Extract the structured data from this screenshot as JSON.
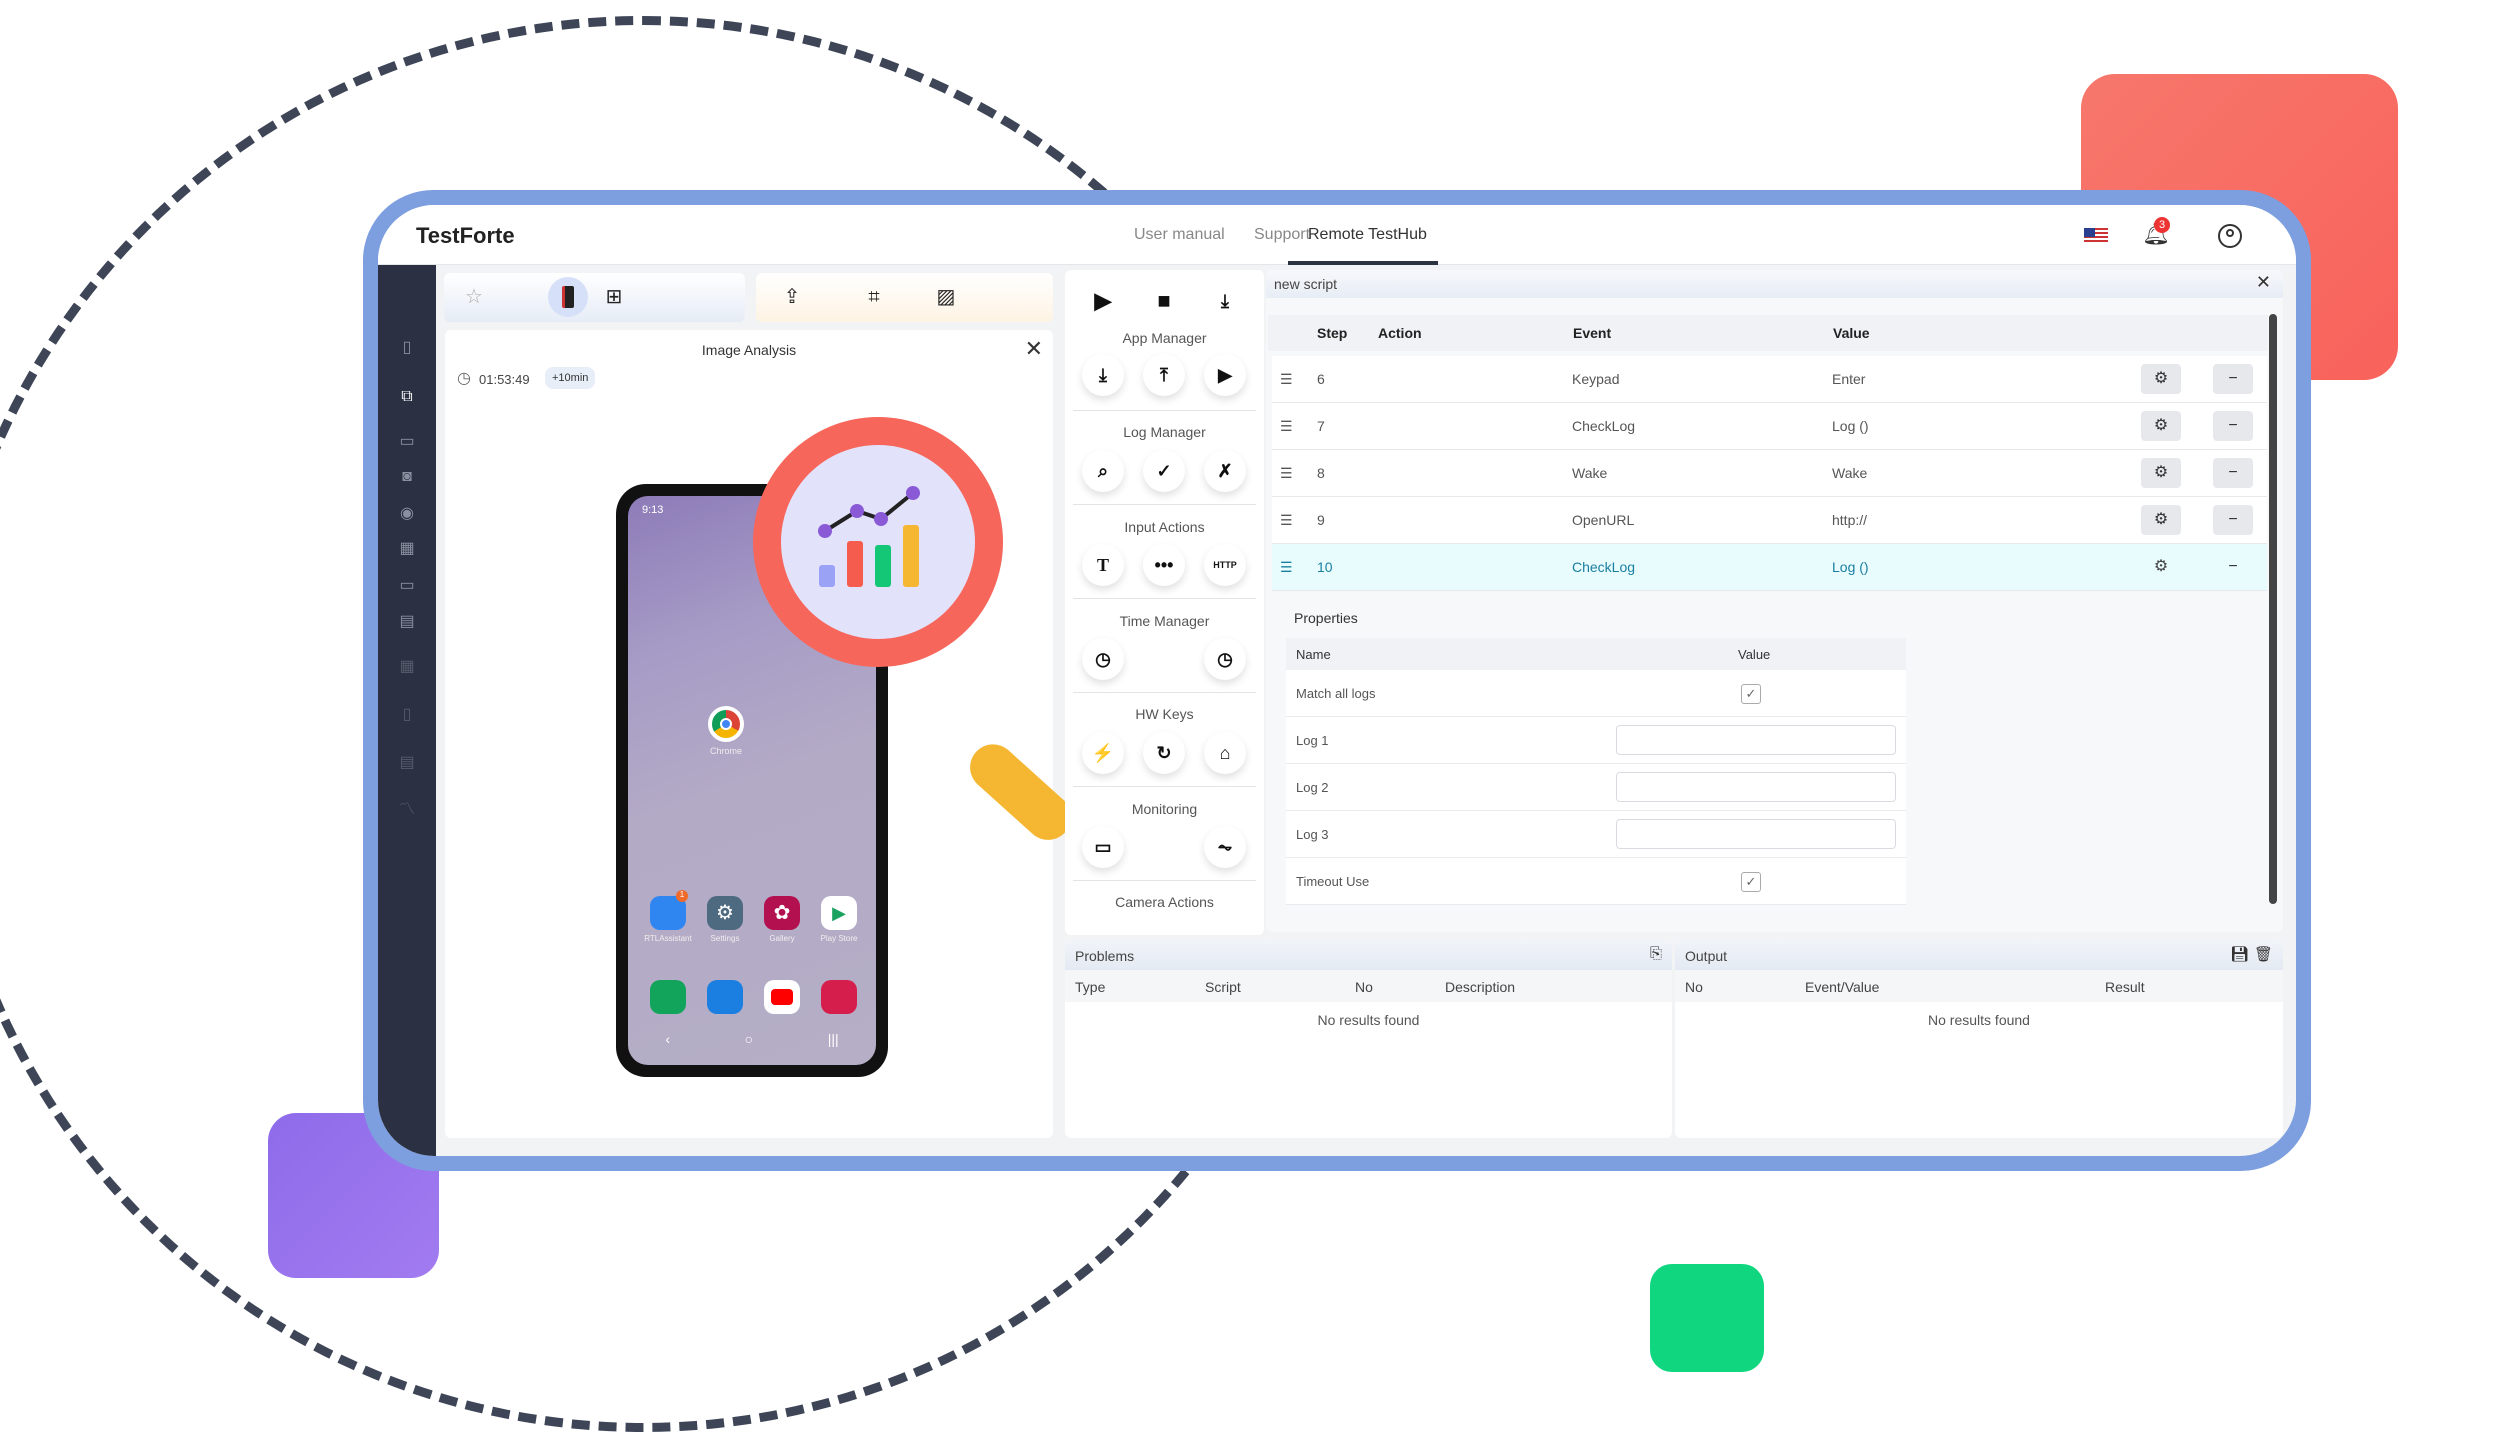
{
  "app": {
    "title": "TestForte"
  },
  "nav": {
    "user_manual": "User manual",
    "support": "Support",
    "remote": "Remote TestHub",
    "notification_count": "3"
  },
  "colors": {
    "frame": "#7d9fe0",
    "sidebar": "#2b3142",
    "highlight_row": "#e8fbfd",
    "accent_text": "#1a7fa0"
  },
  "image_analysis": {
    "title": "Image Analysis",
    "timer": "01:53:49",
    "extend": "+10min"
  },
  "phone": {
    "time": "9:13",
    "apps": [
      "Chrome",
      "RTLAssistant",
      "Settings",
      "Gallery",
      "Play Store"
    ],
    "badge": "1"
  },
  "tools": {
    "sections": [
      "App Manager",
      "Log Manager",
      "Input Actions",
      "Time Manager",
      "HW Keys",
      "Monitoring",
      "Camera Actions"
    ],
    "http_label": "HTTP"
  },
  "script": {
    "title": "new script",
    "columns": [
      "Step",
      "Action",
      "Event",
      "Value"
    ],
    "rows": [
      {
        "step": "6",
        "action": "",
        "event": "Keypad",
        "value": "Enter"
      },
      {
        "step": "7",
        "action": "",
        "event": "CheckLog",
        "value": "Log ()"
      },
      {
        "step": "8",
        "action": "",
        "event": "Wake",
        "value": "Wake"
      },
      {
        "step": "9",
        "action": "",
        "event": "OpenURL",
        "value": "http://"
      },
      {
        "step": "10",
        "action": "",
        "event": "CheckLog",
        "value": "Log ()"
      }
    ],
    "selected_step": "10"
  },
  "properties": {
    "title": "Properties",
    "columns": [
      "Name",
      "Value"
    ],
    "rows": [
      {
        "name": "Match all logs",
        "type": "checkbox",
        "checked": true
      },
      {
        "name": "Log 1",
        "type": "text",
        "value": ""
      },
      {
        "name": "Log 2",
        "type": "text",
        "value": ""
      },
      {
        "name": "Log 3",
        "type": "text",
        "value": ""
      },
      {
        "name": "Timeout Use",
        "type": "checkbox",
        "checked": true
      }
    ]
  },
  "problems": {
    "title": "Problems",
    "columns": [
      "Type",
      "Script",
      "No",
      "Description"
    ],
    "empty": "No results found"
  },
  "output": {
    "title": "Output",
    "columns": [
      "No",
      "Event/Value",
      "Result"
    ],
    "empty": "No results found"
  }
}
